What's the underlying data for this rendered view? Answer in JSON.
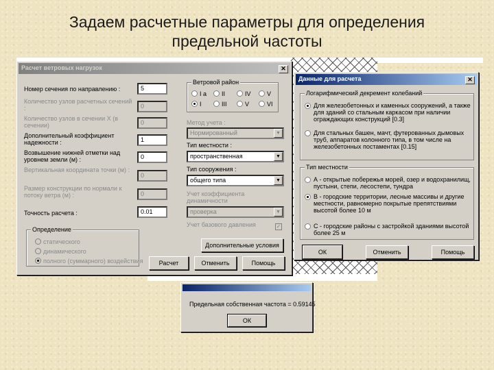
{
  "slide": {
    "title_line1": "Задаем расчетные параметры для определения",
    "title_line2": "предельной частоты"
  },
  "wind_dialog": {
    "title": "Расчет ветровых нагрузок",
    "close_glyph": "✕",
    "rows": [
      {
        "label": "Номер сечения по направлению :",
        "value": "5",
        "disabled": false
      },
      {
        "label": "Количество узлов расчетных сечений :",
        "value": "0",
        "disabled": true
      },
      {
        "label": "Количество узлов в сечении X (в сечении)",
        "value": "0",
        "disabled": true
      },
      {
        "label": "Дополнительный коэффициент надежности :",
        "value": "1",
        "disabled": false
      },
      {
        "label": "Возвышение нижней отметки над уровнем земли (м) :",
        "value": "0",
        "disabled": false
      },
      {
        "label": "Вертикальная координата точки (м) :",
        "value": "0",
        "disabled": true
      },
      {
        "label": "Размер конструкции по нормали к потоку ветра (м) :",
        "value": "0",
        "disabled": true
      },
      {
        "label": "Точность расчета :",
        "value": "0.01",
        "disabled": false
      }
    ],
    "wind_region": {
      "title": "Ветровой район",
      "options": [
        "I а",
        "II",
        "IV",
        "V",
        "I",
        "III",
        "V",
        "VI"
      ],
      "selected": "I"
    },
    "method_label": "Метод учета :",
    "method_value": "Нормированный",
    "terrain_label": "Тип местности :",
    "terrain_value": "пространственная",
    "structure_label": "Тип сооружения :",
    "structure_value": "общего типа",
    "correction_label": "Учет коэффициента динамичности",
    "correction_value": "проверка",
    "checkbox_label": "Учет базового давления",
    "checkbox_mark": "✓",
    "extra_button": "Дополнительные условия",
    "definition": {
      "title": "Определение",
      "options": [
        "статического",
        "динамического",
        "полного (суммарного) воздействия"
      ],
      "selected": 2
    },
    "buttons": {
      "calc": "Расчет",
      "cancel": "Отменить",
      "help": "Помощь"
    }
  },
  "data_dialog": {
    "title": "Данные для расчета",
    "close_glyph": "✕",
    "group1": {
      "title": "Логарифмический декремент колебаний",
      "options": [
        "Для железобетонных и каменных сооружений, а также для зданий со стальным каркасом при наличии ограждающих конструкций [0.3]",
        "Для стальных башен, мачт, футерованных дымовых труб, аппаратов колонного типа, в том числе на железобетонных постаментах [0.15]"
      ],
      "selected": 0
    },
    "group2": {
      "title": "Тип местности",
      "options": [
        "А - открытые побережья морей, озер и водохранилищ, пустыни, степи, лесостепи, тундра",
        "В - городские территории, лесные массивы и другие местности, равномерно покрытые препятствиями высотой более 10 м",
        "С - городские районы с застройкой зданиями высотой более 25 м"
      ],
      "selected": 1
    },
    "buttons": {
      "ok": "ОК",
      "cancel": "Отменить",
      "help": "Помощь"
    }
  },
  "result_dialog": {
    "message": "Предельная собственная частота = 0.59145",
    "ok": "ОК"
  }
}
